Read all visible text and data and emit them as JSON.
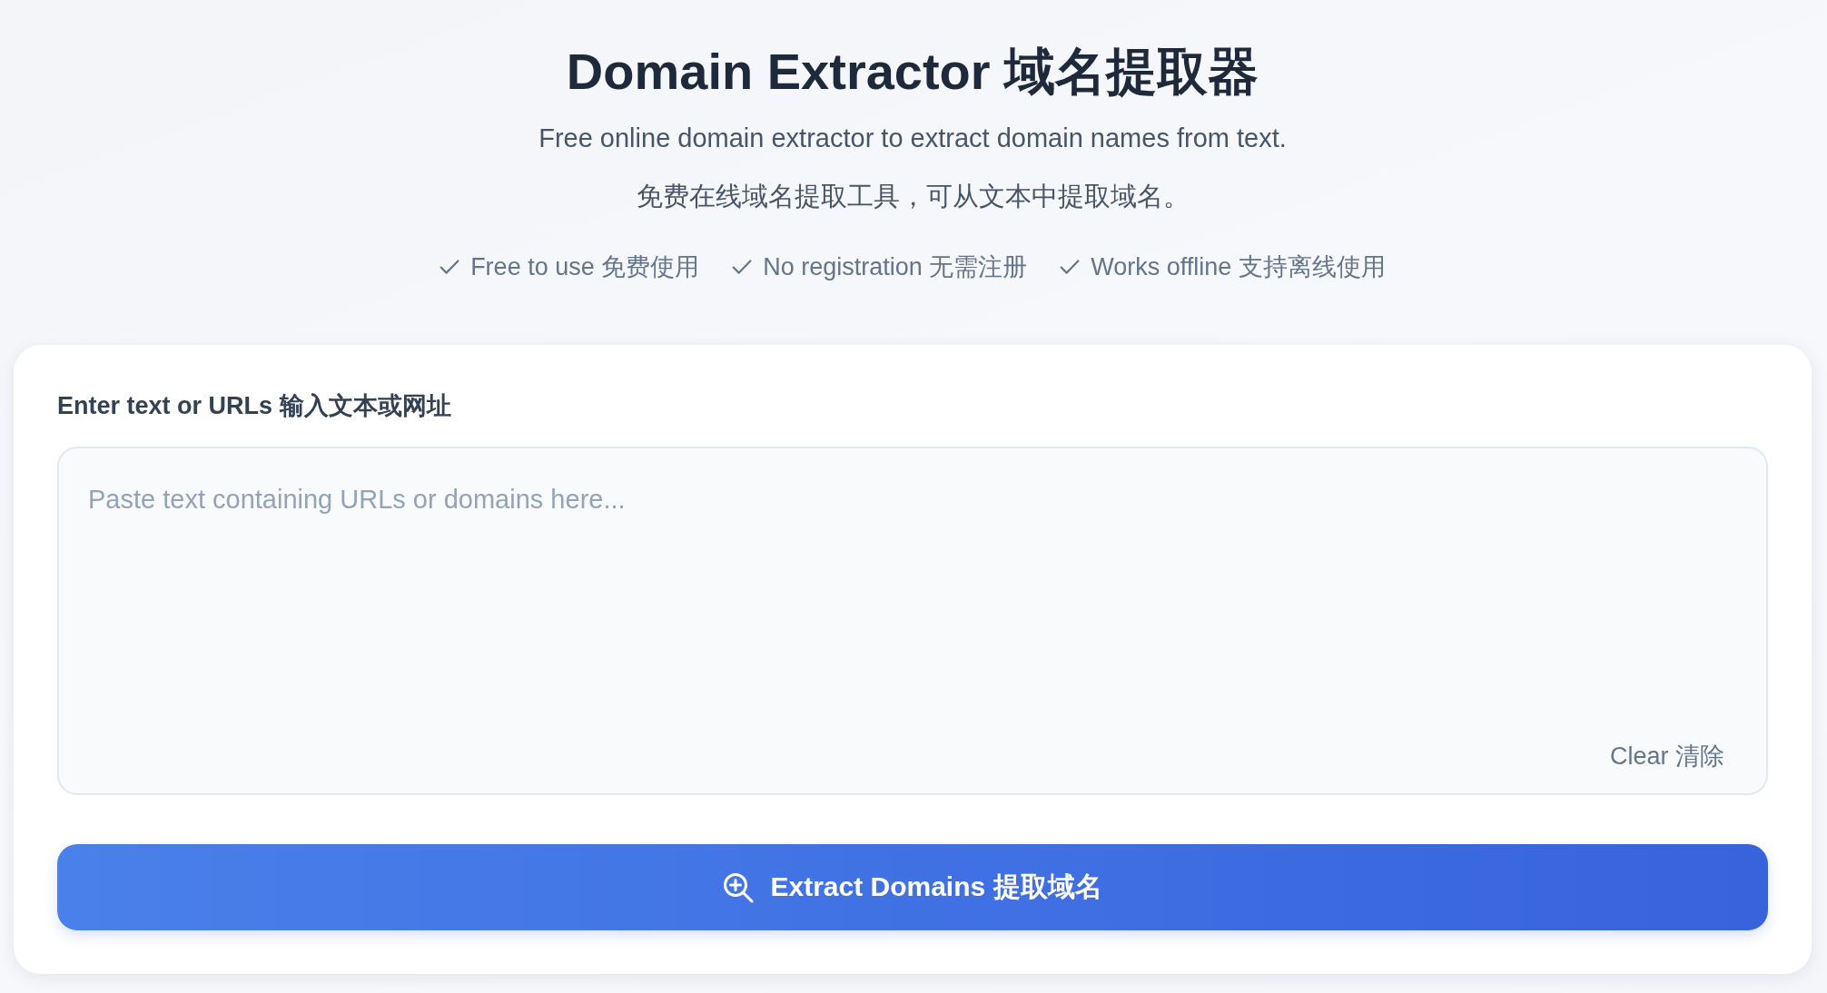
{
  "header": {
    "title": "Domain Extractor 域名提取器",
    "subtitle": "Free online domain extractor to extract domain names from text.",
    "subtitle_zh": "免费在线域名提取工具，可从文本中提取域名。",
    "features": [
      "Free to use 免费使用",
      "No registration 无需注册",
      "Works offline 支持离线使用"
    ]
  },
  "input_card": {
    "label": "Enter text or URLs 输入文本或网址",
    "text_input": {
      "placeholder": "Paste text containing URLs or domains here..."
    },
    "clear_button": "Clear 清除",
    "extract_button": "Extract Domains 提取域名"
  }
}
